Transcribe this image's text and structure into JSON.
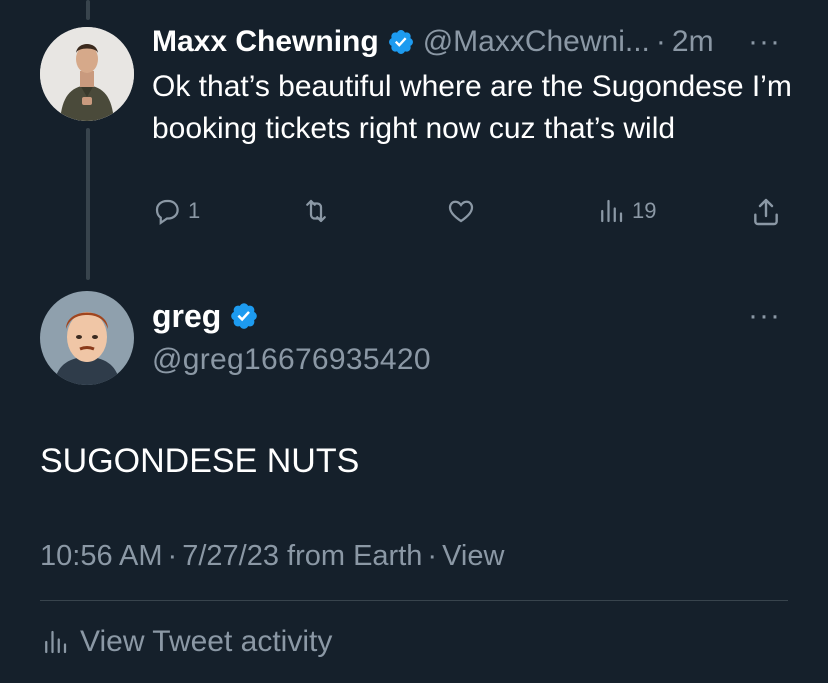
{
  "reply": {
    "name": "Maxx Chewning",
    "handle": "@MaxxChewni...",
    "separator": "·",
    "time": "2m",
    "more": "···",
    "text": "Ok that’s beautiful where are the Sugondese I’m booking tickets right now cuz that’s wild",
    "actions": {
      "reply_count": "1",
      "retweet_count": "",
      "like_count": "",
      "views_count": "19"
    }
  },
  "tweet": {
    "name": "greg",
    "handle": "@greg16676935420",
    "more": "···",
    "text": "SUGONDESE NUTS",
    "meta": {
      "time": "10:56 AM",
      "date": "7/27/23",
      "source": "from Earth",
      "views_label": "View",
      "dot": "·"
    },
    "activity_label": "View Tweet activity"
  },
  "colors": {
    "background": "#15202b",
    "text_primary": "#ffffff",
    "text_secondary": "#8b98a5",
    "verified": "#1d9bf0",
    "divider": "#38444d"
  }
}
